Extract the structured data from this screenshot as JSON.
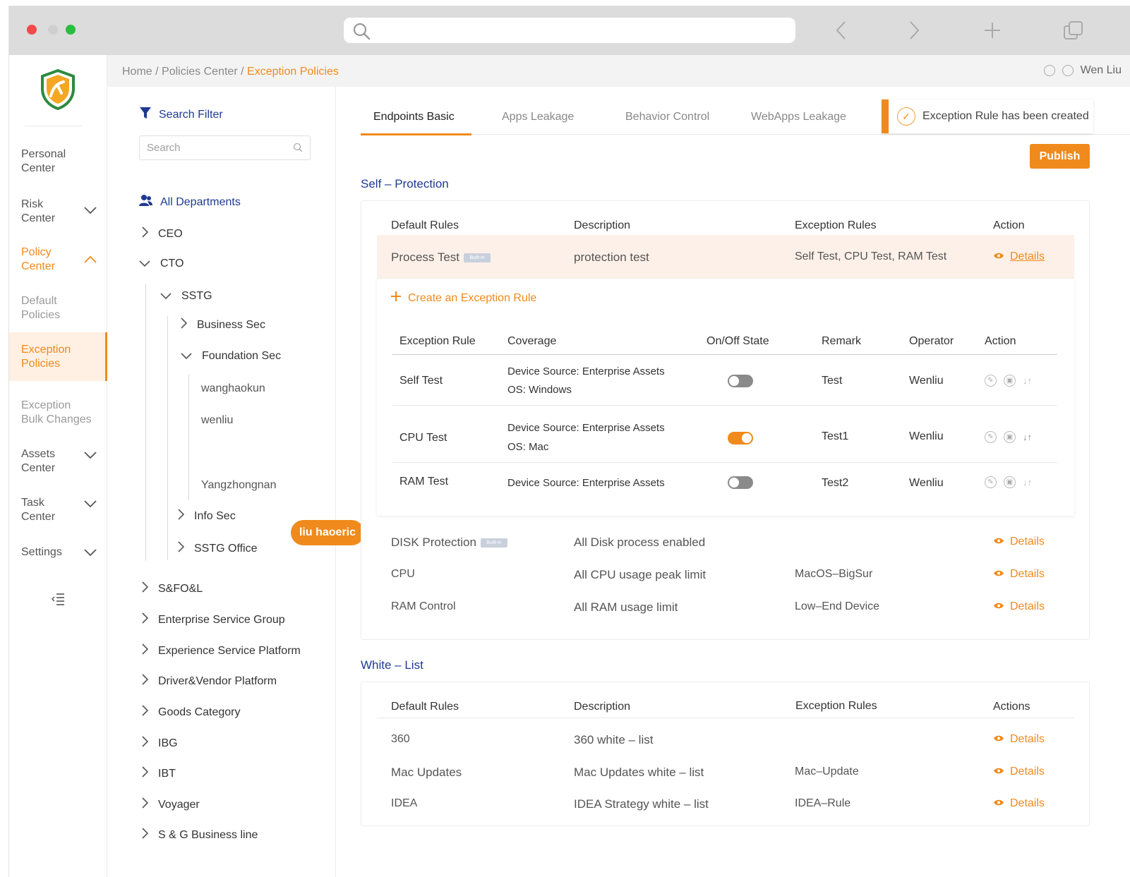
{
  "colors": {
    "accent": "#f08a1c",
    "link_blue": "#1f3a93",
    "highlight_row": "#fdf0e8"
  },
  "browser": {
    "url_placeholder": ""
  },
  "breadcrumb": {
    "home": "Home",
    "sep1": "/",
    "policies": "Policies Center",
    "sep2": "/",
    "current": "Exception Policies"
  },
  "user": {
    "name": "Wen Liu"
  },
  "nav": {
    "personal": [
      "Personal",
      "Center"
    ],
    "risk": [
      "Risk",
      "Center"
    ],
    "policy": [
      "Policy",
      "Center"
    ],
    "default": [
      "Default",
      "Policies"
    ],
    "exception": [
      "Exception",
      "Policies"
    ],
    "bulk": [
      "Exception",
      "Bulk Changes"
    ],
    "assets": [
      "Assets",
      "Center"
    ],
    "task": [
      "Task",
      "Center"
    ],
    "settings": "Settings"
  },
  "tree": {
    "filter_label": "Search Filter",
    "search_placeholder": "Search",
    "all_departments": "All Departments",
    "ceo": "CEO",
    "cto": "CTO",
    "sstg": "SSTG",
    "business_sec": "Business Sec",
    "foundation_sec": "Foundation Sec",
    "wanghaokun": "wanghaokun",
    "wenliu": "wenliu",
    "selected": "liu haoeric",
    "yangzhongnan": "Yangzhongnan",
    "info_sec": "Info Sec",
    "sstg_office": "SSTG Office",
    "others": [
      "S&FO&L",
      "Enterprise Service Group",
      "Experience Service Platform",
      "Driver&Vendor Platform",
      "Goods Category",
      "IBG",
      "IBT",
      "Voyager",
      "S & G Business line"
    ]
  },
  "tabs": [
    "Endpoints Basic",
    "Apps Leakage",
    "Behavior Control",
    "WebApps Leakage"
  ],
  "toast": {
    "text": "Exception Rule has been created"
  },
  "publish_label": "Publish",
  "self_protection": {
    "title": "Self – Protection",
    "headers": [
      "Default Rules",
      "Description",
      "Exception Rules",
      "Action"
    ],
    "highlight": {
      "rule": "Process Test",
      "badge": "Built-in",
      "description": "protection test",
      "exceptions": "Self Test, CPU Test, RAM Test",
      "action": "Details"
    },
    "create_label": "Create an Exception Rule",
    "sub_headers": [
      "Exception Rule",
      "Coverage",
      "On/Off State",
      "Remark",
      "Operator",
      "Action"
    ],
    "sub_rows": [
      {
        "rule": "Self Test",
        "coverage1": "Device Source: Enterprise Assets",
        "coverage2": "OS: Windows",
        "state": false,
        "remark": "Test",
        "operator": "Wenliu"
      },
      {
        "rule": "CPU Test",
        "coverage1": "Device Source: Enterprise Assets",
        "coverage2": "OS: Mac",
        "state": true,
        "remark": "Test1",
        "operator": "Wenliu"
      },
      {
        "rule": "RAM Test",
        "coverage1": "Device Source: Enterprise Assets",
        "coverage2": "",
        "state": false,
        "remark": "Test2",
        "operator": "Wenliu"
      }
    ],
    "rows": [
      {
        "rule": "DISK Protection",
        "badge": "Built-in",
        "description": "All Disk process enabled",
        "exceptions": "",
        "action": "Details"
      },
      {
        "rule": "CPU",
        "description": "All CPU usage peak limit",
        "exceptions": "MacOS–BigSur",
        "action": "Details"
      },
      {
        "rule": "RAM Control",
        "description": "All RAM usage limit",
        "exceptions": "Low–End Device",
        "action": "Details"
      }
    ]
  },
  "white_list": {
    "title": "White – List",
    "headers": [
      "Default Rules",
      "Description",
      "Exception Rules",
      "Actions"
    ],
    "rows": [
      {
        "rule": "360",
        "description": "360 white – list",
        "exceptions": "",
        "action": "Details"
      },
      {
        "rule": "Mac Updates",
        "description": "Mac Updates white – list",
        "exceptions": "Mac–Update",
        "action": "Details"
      },
      {
        "rule": "IDEA",
        "description": "IDEA Strategy white – list",
        "exceptions": "IDEA–Rule",
        "action": "Details"
      }
    ]
  }
}
